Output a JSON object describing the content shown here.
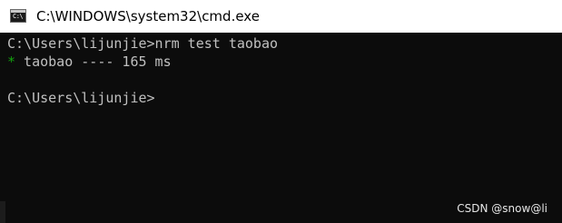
{
  "window": {
    "title": "C:\\WINDOWS\\system32\\cmd.exe",
    "icon_glyph": "C:\\",
    "icon": "cmd-icon"
  },
  "console": {
    "line1": "C:\\Users\\lijunjie>nrm test taobao",
    "line2_marker": "*",
    "line2_text": " taobao ---- 165 ms",
    "line4": "C:\\Users\\lijunjie>"
  },
  "watermark": {
    "text": "CSDN @snow@li"
  },
  "colors": {
    "console_bg": "#0c0c0c",
    "console_text": "#c0c0c0",
    "marker": "#13a10e",
    "titlebar_bg": "#ffffff"
  }
}
